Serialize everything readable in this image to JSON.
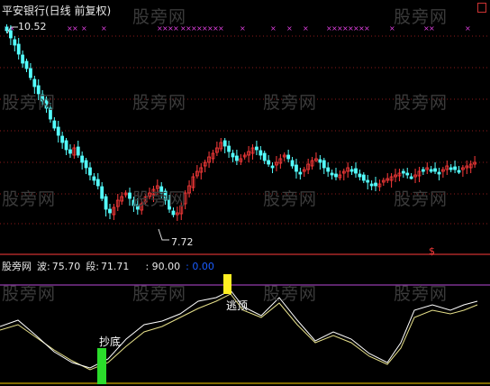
{
  "chart_title": "平安银行(日线 前复权)",
  "price_high_label": "10.52",
  "price_low_label": "7.72",
  "indicator": {
    "name": "股旁网",
    "wave_label": "波:",
    "wave_value": "75.70",
    "segment_label": "段:",
    "segment_value": "71.71",
    "level_upper": ": 90.00",
    "level_lower": ": 0.00"
  },
  "annotations": {
    "bottom_signal": "抄底",
    "top_signal": "逃顶"
  },
  "dollar_marker": "$",
  "watermark": "股旁网",
  "colors": {
    "background": "#000000",
    "up_candle": "#ff3b3b",
    "down_candle": "#54ffff",
    "gridline_dotted": "#8b1a1a",
    "panel_divider": "#ff3b3b",
    "upper_level_line": "#b84ad8",
    "lower_level_line": "#ffd400",
    "wave_line": "#ffffff",
    "segment_line": "#e6e08a",
    "bottom_bar": "#2bdc2b",
    "top_bar": "#ffee22",
    "x_marks": "#e040e0"
  },
  "icons": {
    "corner": "maximize-icon"
  }
}
